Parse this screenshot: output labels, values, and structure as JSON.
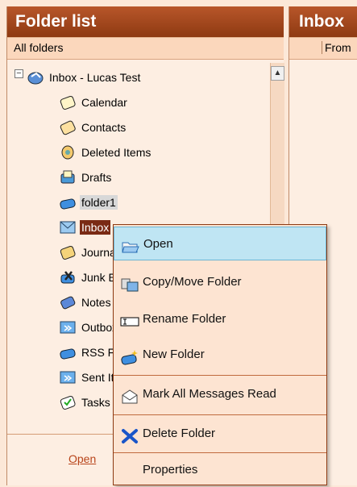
{
  "folder_pane": {
    "title": "Folder list",
    "subhead": "All folders",
    "root": {
      "label": "Inbox - Lucas Test",
      "expander": "−"
    },
    "items": [
      {
        "label": "Calendar",
        "icon": "calendar-icon"
      },
      {
        "label": "Contacts",
        "icon": "contacts-icon"
      },
      {
        "label": "Deleted Items",
        "icon": "deleted-items-icon"
      },
      {
        "label": "Drafts",
        "icon": "drafts-icon"
      },
      {
        "label": "folder1",
        "icon": "folder-icon"
      },
      {
        "label": "Inbox",
        "icon": "inbox-icon"
      },
      {
        "label": "Journal",
        "icon": "journal-icon"
      },
      {
        "label": "Junk E-mail",
        "icon": "junk-icon"
      },
      {
        "label": "Notes",
        "icon": "notes-icon"
      },
      {
        "label": "Outbox",
        "icon": "outbox-icon"
      },
      {
        "label": "RSS Feeds",
        "icon": "rss-icon"
      },
      {
        "label": "Sent Items",
        "icon": "sent-items-icon"
      },
      {
        "label": "Tasks",
        "icon": "tasks-icon"
      }
    ],
    "footer_link": "Open"
  },
  "inbox_pane": {
    "title": "Inbox",
    "column_from": "From"
  },
  "context_menu": {
    "items": [
      {
        "label": "Open",
        "icon": "open-folder-icon"
      },
      {
        "label": "Copy/Move Folder",
        "icon": "copy-move-icon"
      },
      {
        "label": "Rename Folder",
        "icon": "rename-icon"
      },
      {
        "label": "New Folder",
        "icon": "new-folder-icon"
      },
      {
        "label": "Mark All Messages Read",
        "icon": "envelope-icon"
      },
      {
        "label": "Delete Folder",
        "icon": "delete-icon"
      },
      {
        "label": "Properties",
        "icon": ""
      }
    ]
  },
  "colors": {
    "title_bar": "#a2471c",
    "background": "#fce8d8",
    "menu_highlight": "#bfe5f3",
    "selected_folder": "#7a2a14"
  }
}
